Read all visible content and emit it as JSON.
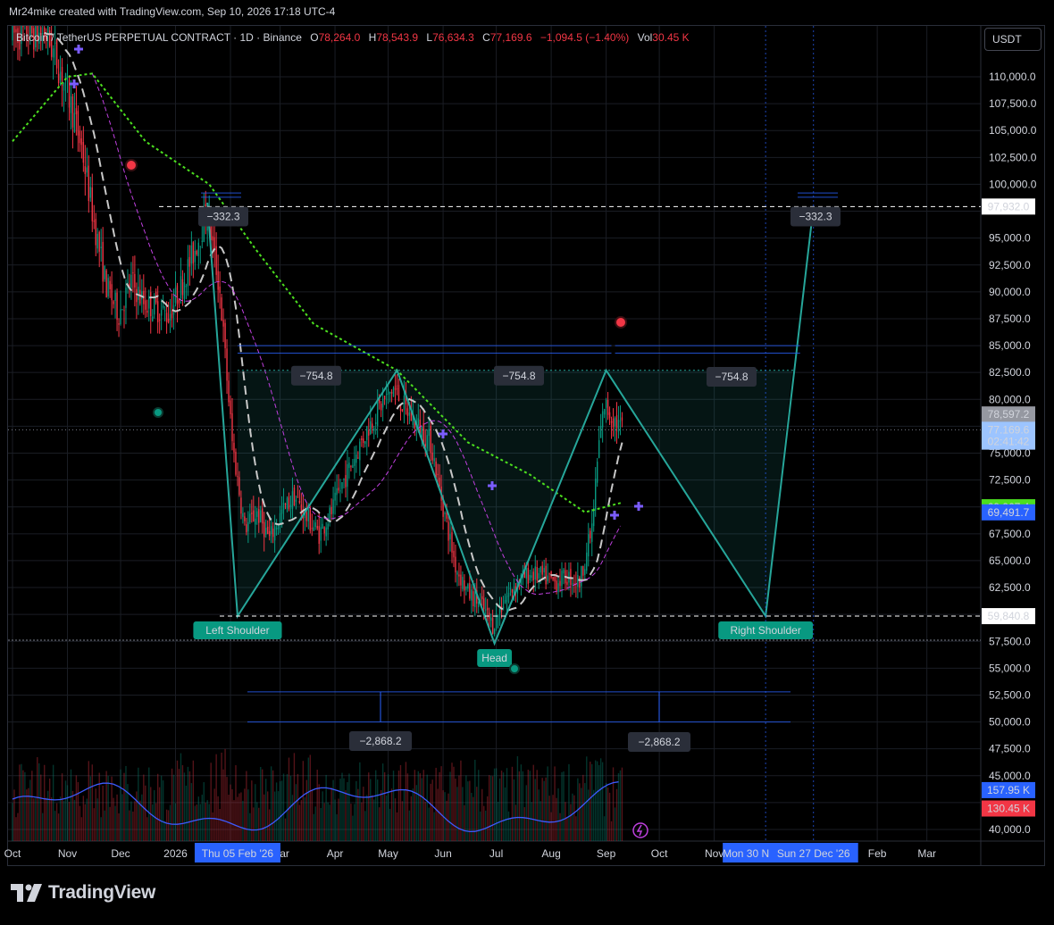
{
  "credit": "Mr24mike created with TradingView.com, Sep 10, 2026 17:18 UTC-4",
  "header": {
    "symbol": "Bitcoin / TetherUS PERPETUAL CONTRACT · 1D · Binance",
    "o_label": "O",
    "o": "78,264.0",
    "h_label": "H",
    "h": "78,543.9",
    "l_label": "L",
    "l": "76,634.3",
    "c_label": "C",
    "c": "77,169.6",
    "change": "−1,094.5 (−1.40%)",
    "vol_label": "Vol",
    "vol": "30.45 K"
  },
  "currency": "USDT",
  "footer": {
    "brand": "TradingView"
  },
  "colors": {
    "up": "#089981",
    "down": "#f23645",
    "pattern": "#26a69a",
    "green_ma": "#4cdf1f",
    "purple_ma": "#c040e0",
    "blue": "#2962ff",
    "volume_ma": "#3d5afe"
  },
  "chart_data": {
    "type": "candlestick",
    "title": "Bitcoin / TetherUS PERPETUAL CONTRACT · 1D · Binance",
    "ylim": [
      39000,
      114000
    ],
    "y_ticks": [
      "110,000.0",
      "107,500.0",
      "105,000.0",
      "102,500.0",
      "100,000.0",
      "95,000.0",
      "92,500.0",
      "90,000.0",
      "87,500.0",
      "85,000.0",
      "82,500.0",
      "80,000.0",
      "75,000.0",
      "72,500.0",
      "67,500.0",
      "65,000.0",
      "62,500.0",
      "57,500.0",
      "55,000.0",
      "52,500.0",
      "50,000.0",
      "47,500.0",
      "45,000.0",
      "40,000.0"
    ],
    "x_ticks": [
      "Oct",
      "Nov",
      "Dec",
      "2026",
      "Mar",
      "Apr",
      "May",
      "Jun",
      "Jul",
      "Aug",
      "Sep",
      "Oct",
      "Nov",
      "Feb",
      "Mar"
    ],
    "x_highlight_labels": [
      "Thu 05 Feb '26",
      "Mon 30 N",
      "Sun 27 Dec '26"
    ],
    "price_labels": [
      {
        "text": "97,932.0",
        "value": 97932,
        "style": "white"
      },
      {
        "text": "78,597.2",
        "value": 78597.2,
        "style": "gray"
      },
      {
        "text": "77,169.6",
        "value": 77169.6,
        "style": "lightblue"
      },
      {
        "text": "02:41:42",
        "value": 76070,
        "style": "lightblue"
      },
      {
        "text": "69,967.4",
        "value": 69967.4,
        "style": "green"
      },
      {
        "text": "69,491.7",
        "value": 69491.7,
        "style": "blue"
      },
      {
        "text": "59,840.8",
        "value": 59840.8,
        "style": "white"
      },
      {
        "text": "157.95 K",
        "value": 43660,
        "style": "blue"
      },
      {
        "text": "130.45 K",
        "value": 41950,
        "style": "red"
      }
    ],
    "pattern": {
      "name": "Head and Shoulders (inverse)",
      "labels": [
        "Left Shoulder",
        "Head",
        "Right Shoulder"
      ],
      "points": [
        {
          "date": "2026-01-19",
          "price": 98300
        },
        {
          "date": "2026-02-05",
          "price": 59841
        },
        {
          "date": "2026-05-06",
          "price": 82700
        },
        {
          "date": "2026-06-30",
          "price": 57300
        },
        {
          "date": "2026-09-01",
          "price": 82700
        },
        {
          "date": "2026-11-30",
          "price": 59841
        },
        {
          "date": "2026-12-27",
          "price": 97932
        }
      ],
      "neckline": 82700,
      "measurements": [
        "−332.3",
        "−754.8",
        "−754.8",
        "−754.8",
        "−332.3",
        "−2,868.2",
        "−2,868.2"
      ]
    },
    "trend_path_points": [
      {
        "date": "2025-10-20",
        "price": 114000
      },
      {
        "date": "2025-10-26",
        "price": 111500
      },
      {
        "date": "2025-11-02",
        "price": 108000
      },
      {
        "date": "2025-11-09",
        "price": 103500
      },
      {
        "date": "2025-11-16",
        "price": 96500
      },
      {
        "date": "2025-11-23",
        "price": 90500
      },
      {
        "date": "2025-11-30",
        "price": 88000
      },
      {
        "date": "2025-12-07",
        "price": 91000
      },
      {
        "date": "2025-12-14",
        "price": 89000
      },
      {
        "date": "2025-12-21",
        "price": 88500
      },
      {
        "date": "2025-12-28",
        "price": 87800
      },
      {
        "date": "2026-01-04",
        "price": 90500
      },
      {
        "date": "2026-01-11",
        "price": 93500
      },
      {
        "date": "2026-01-19",
        "price": 97500
      },
      {
        "date": "2026-01-26",
        "price": 90000
      },
      {
        "date": "2026-02-02",
        "price": 76000
      },
      {
        "date": "2026-02-09",
        "price": 68000
      },
      {
        "date": "2026-02-16",
        "price": 69500
      },
      {
        "date": "2026-02-23",
        "price": 67000
      },
      {
        "date": "2026-03-02",
        "price": 69500
      },
      {
        "date": "2026-03-09",
        "price": 71000
      },
      {
        "date": "2026-03-16",
        "price": 69000
      },
      {
        "date": "2026-03-23",
        "price": 67500
      },
      {
        "date": "2026-03-30",
        "price": 69500
      },
      {
        "date": "2026-04-06",
        "price": 72500
      },
      {
        "date": "2026-04-13",
        "price": 75000
      },
      {
        "date": "2026-04-20",
        "price": 77500
      },
      {
        "date": "2026-04-27",
        "price": 79500
      },
      {
        "date": "2026-05-04",
        "price": 81000
      },
      {
        "date": "2026-05-11",
        "price": 79000
      },
      {
        "date": "2026-05-18",
        "price": 77500
      },
      {
        "date": "2026-05-25",
        "price": 76000
      },
      {
        "date": "2026-06-01",
        "price": 70000
      },
      {
        "date": "2026-06-08",
        "price": 64500
      },
      {
        "date": "2026-06-15",
        "price": 62000
      },
      {
        "date": "2026-06-22",
        "price": 61000
      },
      {
        "date": "2026-06-29",
        "price": 59000
      },
      {
        "date": "2026-07-06",
        "price": 61500
      },
      {
        "date": "2026-07-13",
        "price": 63000
      },
      {
        "date": "2026-07-20",
        "price": 63800
      },
      {
        "date": "2026-07-27",
        "price": 63500
      },
      {
        "date": "2026-08-03",
        "price": 63000
      },
      {
        "date": "2026-08-10",
        "price": 63500
      },
      {
        "date": "2026-08-17",
        "price": 63000
      },
      {
        "date": "2026-08-24",
        "price": 68000
      },
      {
        "date": "2026-08-28",
        "price": 76000
      },
      {
        "date": "2026-08-31",
        "price": 79500
      },
      {
        "date": "2026-09-04",
        "price": 78500
      },
      {
        "date": "2026-09-10",
        "price": 77169.6
      }
    ]
  }
}
